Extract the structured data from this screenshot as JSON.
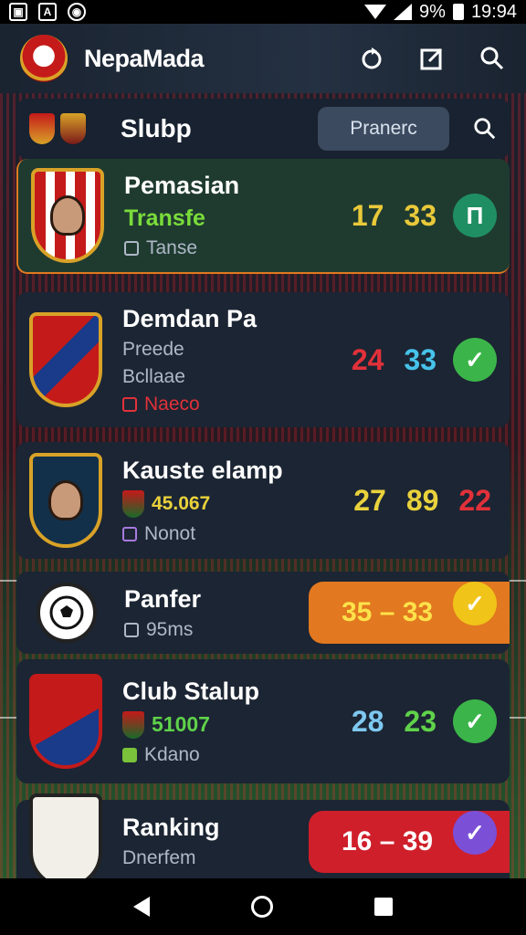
{
  "status_bar": {
    "icons": [
      "image-icon",
      "a-icon",
      "circle-icon"
    ],
    "battery": "9%",
    "time": "19:94"
  },
  "app_bar": {
    "title": "NepaMada",
    "actions": [
      "refresh-icon",
      "edit-icon",
      "search-icon"
    ]
  },
  "header": {
    "title": "Slubp",
    "chip": "Pranerc"
  },
  "items": [
    {
      "title": "Pemasian",
      "sub1": "Transfe",
      "sub2": "Tanse",
      "scores": [
        "17",
        "33"
      ],
      "score_colors": [
        "#e9c93a",
        "#e9c93a"
      ],
      "status": "П",
      "status_color": "#1f8f63"
    },
    {
      "title": "Demdan Pa",
      "sub1": "Preede",
      "sub2": "Bcllaae",
      "sub3": "Naeco",
      "scores": [
        "24",
        "33"
      ],
      "score_colors": [
        "#e2313a",
        "#46c3ea"
      ],
      "status": "✓",
      "status_color": "#3bb54a"
    },
    {
      "title": "Kauste elamp",
      "sub1": "45.067",
      "sub2": "Nonot",
      "scores": [
        "27",
        "89",
        "22"
      ],
      "score_colors": [
        "#e9d23c",
        "#e9d23c",
        "#e2313a"
      ]
    },
    {
      "title": "Panfer",
      "sub1": "95ms",
      "pill": "35 – 33",
      "pill_color": "#e2781f",
      "status": "✓",
      "status_color": "#f0c419"
    },
    {
      "title": "Club Stalup",
      "sub1": "51007",
      "sub2": "Kdano",
      "scores": [
        "28",
        "23"
      ],
      "score_colors": [
        "#7ec8f0",
        "#5fd24a"
      ],
      "status": "✓",
      "status_color": "#3bb54a"
    },
    {
      "title": "Ranking",
      "sub1": "Dnerfem",
      "pill": "16 – 39",
      "pill_color": "#cf1f2a",
      "status": "✓",
      "status_color": "#7b4fd6"
    }
  ],
  "nav_bar": [
    "back-icon",
    "home-icon",
    "recents-icon"
  ]
}
